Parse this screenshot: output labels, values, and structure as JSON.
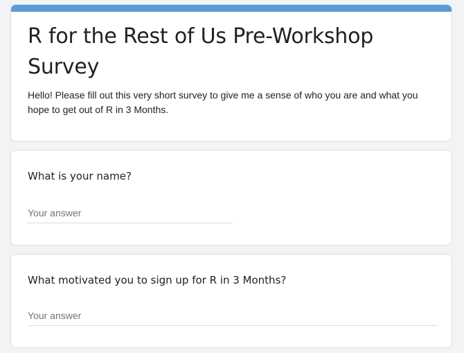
{
  "form": {
    "title": "R for the Rest of Us Pre-Workshop Survey",
    "description": "Hello! Please fill out this very short survey to give me a sense of who you are and what you hope to get out of R in 3 Months.",
    "accent_color": "#5b9bd5"
  },
  "questions": [
    {
      "title": "What is your name?",
      "placeholder": "Your answer",
      "value": ""
    },
    {
      "title": "What motivated you to sign up for R in 3 Months?",
      "placeholder": "Your answer",
      "value": ""
    }
  ]
}
